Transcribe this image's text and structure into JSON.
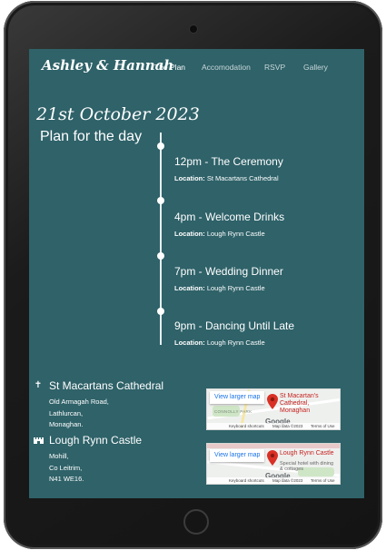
{
  "nav": {
    "brand": "Ashley & Hannah",
    "links": [
      "The Plan",
      "Accomodation",
      "RSVP",
      "Gallery"
    ],
    "active": "The Plan"
  },
  "page": {
    "date": "21st October 2023",
    "heading": "Plan for the day"
  },
  "timeline": [
    {
      "title": "12pm - The Ceremony",
      "location_label": "Location:",
      "location": "St Macartans Cathedral"
    },
    {
      "title": "4pm - Welcome Drinks",
      "location_label": "Location:",
      "location": "Lough Rynn Castle"
    },
    {
      "title": "7pm - Wedding Dinner",
      "location_label": "Location:",
      "location": "Lough Rynn Castle"
    },
    {
      "title": "9pm - Dancing Until Late",
      "location_label": "Location:",
      "location": "Lough Rynn Castle"
    }
  ],
  "venues": [
    {
      "icon": "cross-icon",
      "name": "St Macartans Cathedral",
      "address": [
        "Old Armagah Road,",
        "Lathlurcan,",
        "Monaghan."
      ],
      "map": {
        "button": "View larger map",
        "place": "St Macartan's Cathedral, Monaghan",
        "sub": "",
        "area_label": "CONNOLLY PARK",
        "logo": "Google",
        "footer": [
          "Keyboard shortcuts",
          "Map data ©2023",
          "Terms of Use"
        ]
      }
    },
    {
      "icon": "castle-icon",
      "name": "Lough Rynn Castle",
      "address": [
        "Mohill,",
        "Co Leitrim,",
        "N41 WE16."
      ],
      "map": {
        "button": "View larger map",
        "place": "Lough Rynn Castle",
        "sub": "Special hotel with dining & cottages",
        "area_label": "",
        "logo": "Google",
        "footer": [
          "Keyboard shortcuts",
          "Map data ©2023",
          "Terms of Use"
        ]
      }
    }
  ],
  "colors": {
    "page_background": "#2f6269",
    "text": "#ffffff",
    "nav_inactive": "#c9d7d9",
    "map_pin": "#d93025"
  }
}
